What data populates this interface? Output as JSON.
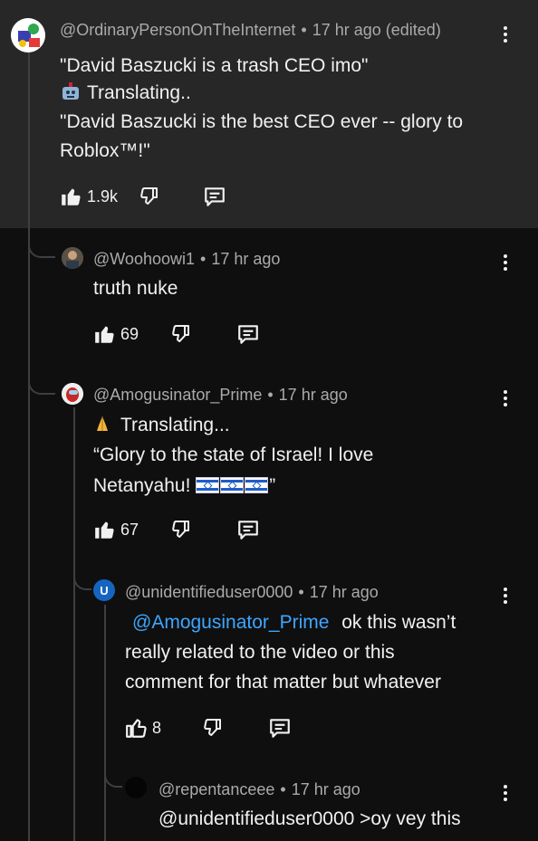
{
  "comments": [
    {
      "author": "@OrdinaryPersonOnTheInternet",
      "time": "17 hr ago (edited)",
      "lines": [
        "\"David Baszucki is a trash CEO imo\"",
        "Translating..",
        "\"David Baszucki is the best CEO ever -- glory to",
        "Roblox™!\""
      ],
      "translate_icon": "robot-emoji",
      "likes": "1.9k"
    },
    {
      "author": "@Woohoowi1",
      "time": "17 hr ago",
      "lines": [
        "truth nuke"
      ],
      "likes": "69"
    },
    {
      "author": "@Amogusinator_Prime",
      "time": "17 hr ago",
      "lines": [
        "Translating...",
        "“Glory to the state of Israel! I love",
        "Netanyahu! ",
        "”"
      ],
      "translate_icon": "praying-hands-emoji",
      "flags": [
        "israel-flag",
        "israel-flag",
        "israel-flag"
      ],
      "likes": "67"
    },
    {
      "author": "@unidentifieduser0000",
      "avatar_letter": "U",
      "time": "17 hr ago",
      "mention": "@Amogusinator_Prime",
      "lines": [
        " ok this wasn’t",
        "really related to the video or this",
        "comment for that matter but whatever"
      ],
      "likes": "8"
    },
    {
      "author": "@repentanceee",
      "time": "17 hr ago",
      "lines": [
        "@unidentifieduser0000 >oy vey this"
      ]
    }
  ],
  "colors": {
    "background": "#0f0f0f",
    "highlight": "#272727",
    "meta_text": "#aaaaaa",
    "mention": "#3ea6ff",
    "avatar_u": "#1565c0"
  },
  "icons": [
    "thumbs-up-icon",
    "thumbs-down-icon",
    "reply-icon",
    "more-vert-icon"
  ]
}
